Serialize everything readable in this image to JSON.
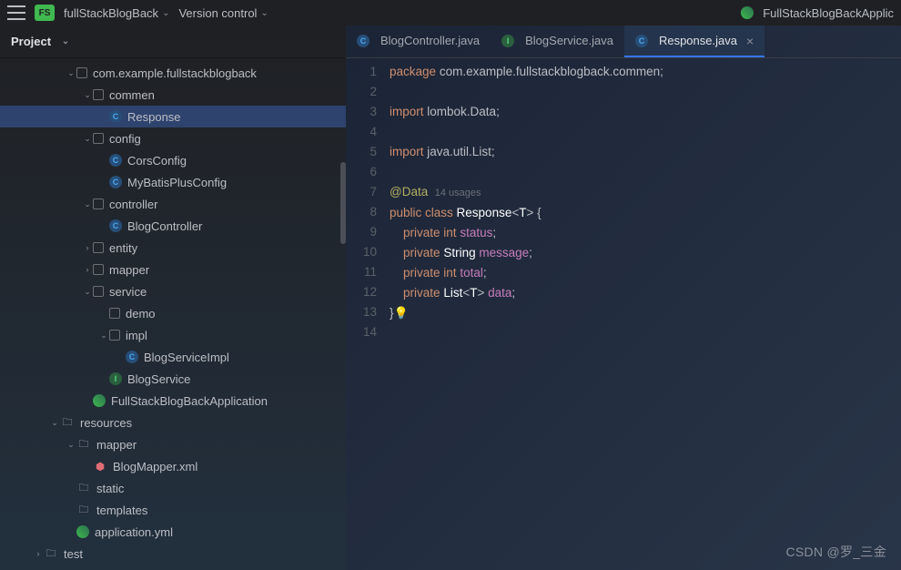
{
  "topbar": {
    "project_badge": "FS",
    "project_name": "fullStackBlogBack",
    "vcs": "Version control",
    "run_config": "FullStackBlogBackApplic"
  },
  "sidebar": {
    "title": "Project",
    "tree": [
      {
        "depth": 4,
        "arr": "v",
        "icon": "pkg",
        "label": "com.example.fullstackblogback"
      },
      {
        "depth": 5,
        "arr": "v",
        "icon": "pkg",
        "label": "commen"
      },
      {
        "depth": 6,
        "arr": "",
        "icon": "class",
        "label": "Response",
        "sel": true
      },
      {
        "depth": 5,
        "arr": "v",
        "icon": "pkg",
        "label": "config"
      },
      {
        "depth": 6,
        "arr": "",
        "icon": "class",
        "label": "CorsConfig"
      },
      {
        "depth": 6,
        "arr": "",
        "icon": "class",
        "label": "MyBatisPlusConfig"
      },
      {
        "depth": 5,
        "arr": "v",
        "icon": "pkg",
        "label": "controller"
      },
      {
        "depth": 6,
        "arr": "",
        "icon": "class",
        "label": "BlogController"
      },
      {
        "depth": 5,
        "arr": ">",
        "icon": "pkg",
        "label": "entity"
      },
      {
        "depth": 5,
        "arr": ">",
        "icon": "pkg",
        "label": "mapper"
      },
      {
        "depth": 5,
        "arr": "v",
        "icon": "pkg",
        "label": "service"
      },
      {
        "depth": 6,
        "arr": "",
        "icon": "pkg",
        "label": "demo"
      },
      {
        "depth": 6,
        "arr": "v",
        "icon": "pkg",
        "label": "impl"
      },
      {
        "depth": 7,
        "arr": "",
        "icon": "class",
        "label": "BlogServiceImpl"
      },
      {
        "depth": 6,
        "arr": "",
        "icon": "int",
        "label": "BlogService"
      },
      {
        "depth": 5,
        "arr": "",
        "icon": "run",
        "label": "FullStackBlogBackApplication"
      },
      {
        "depth": 3,
        "arr": "v",
        "icon": "fold",
        "label": "resources"
      },
      {
        "depth": 4,
        "arr": "v",
        "icon": "fold",
        "label": "mapper"
      },
      {
        "depth": 5,
        "arr": "",
        "icon": "xml",
        "label": "BlogMapper.xml"
      },
      {
        "depth": 4,
        "arr": "",
        "icon": "fold",
        "label": "static"
      },
      {
        "depth": 4,
        "arr": "",
        "icon": "fold",
        "label": "templates"
      },
      {
        "depth": 4,
        "arr": "",
        "icon": "run",
        "label": "application.yml"
      },
      {
        "depth": 2,
        "arr": ">",
        "icon": "fold",
        "label": "test"
      }
    ]
  },
  "tabs": [
    {
      "icon": "class",
      "label": "BlogController.java",
      "active": false,
      "close": false
    },
    {
      "icon": "int",
      "label": "BlogService.java",
      "active": false,
      "close": false
    },
    {
      "icon": "class",
      "label": "Response.java",
      "active": true,
      "close": true
    }
  ],
  "code": {
    "lines": [
      {
        "n": 1,
        "html": "<span class='kw'>package</span> <span class='pkg'>com.example.fullstackblogback.commen;</span>"
      },
      {
        "n": 2,
        "html": ""
      },
      {
        "n": 3,
        "html": "<span class='kw'>import</span> <span class='pkg'>lombok.Data;</span>"
      },
      {
        "n": 4,
        "html": ""
      },
      {
        "n": 5,
        "html": "<span class='kw'>import</span> <span class='pkg'>java.util.List;</span>"
      },
      {
        "n": 6,
        "html": ""
      },
      {
        "n": 7,
        "html": "<span class='ann'>@Data</span>  <span class='hint'>14 usages</span>"
      },
      {
        "n": 8,
        "html": "<span class='kw'>public class</span> <span class='typ'>Response</span>&lt;<span class='typ'>T</span>&gt; {"
      },
      {
        "n": 9,
        "html": "    <span class='kw'>private int</span> <span class='fld'>status</span>;"
      },
      {
        "n": 10,
        "html": "    <span class='kw'>private</span> <span class='typ'>String</span> <span class='fld'>message</span>;"
      },
      {
        "n": 11,
        "html": "    <span class='kw'>private int</span> <span class='fld'>total</span>;"
      },
      {
        "n": 12,
        "html": "    <span class='kw'>private</span> <span class='typ'>List</span>&lt;<span class='typ'>T</span>&gt; <span class='fld'>data</span>;"
      },
      {
        "n": 13,
        "html": "}<span class='bulb'>💡</span>"
      },
      {
        "n": 14,
        "html": ""
      }
    ]
  },
  "watermark": "CSDN @罗_三金"
}
